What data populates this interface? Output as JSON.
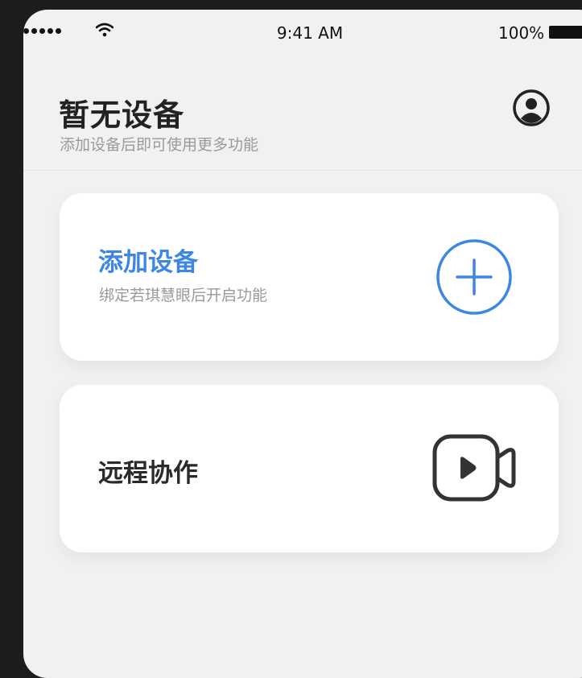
{
  "status_bar": {
    "time": "9:41 AM",
    "battery": "100%"
  },
  "header": {
    "title": "暂无设备",
    "subtitle": "添加设备后即可使用更多功能"
  },
  "cards": [
    {
      "title": "添加设备",
      "subtitle": "绑定若琪慧眼后开启功能",
      "icon": "plus-circle-icon"
    },
    {
      "title": "远程协作",
      "icon": "video-camera-icon"
    }
  ],
  "colors": {
    "accent": "#3d86e6",
    "background": "#f1f1f2",
    "card": "#ffffff"
  }
}
